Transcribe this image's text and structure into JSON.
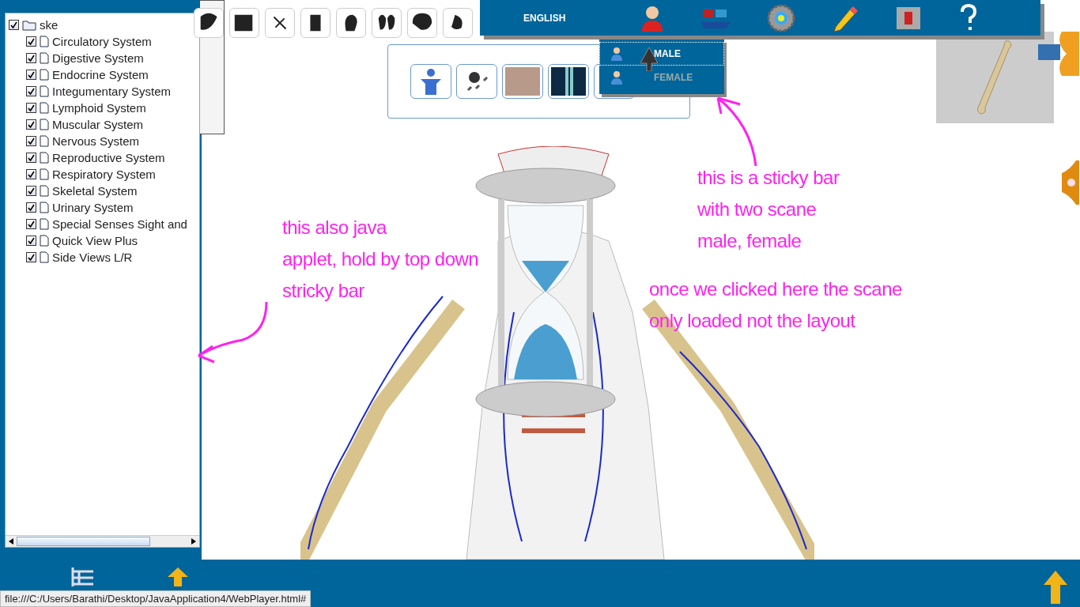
{
  "tree": {
    "root": {
      "label": "ske",
      "checked": true
    },
    "items": [
      {
        "label": "Circulatory System",
        "checked": true
      },
      {
        "label": "Digestive System",
        "checked": true
      },
      {
        "label": "Endocrine System",
        "checked": true
      },
      {
        "label": "Integumentary System",
        "checked": true
      },
      {
        "label": "Lymphoid System",
        "checked": true
      },
      {
        "label": "Muscular System",
        "checked": true
      },
      {
        "label": "Nervous System",
        "checked": true
      },
      {
        "label": "Reproductive System",
        "checked": true
      },
      {
        "label": "Respiratory System",
        "checked": true
      },
      {
        "label": "Skeletal System",
        "checked": true
      },
      {
        "label": "Urinary System",
        "checked": true
      },
      {
        "label": "Special Senses Sight and",
        "checked": true
      },
      {
        "label": "Quick View Plus",
        "checked": true
      },
      {
        "label": "Side Views L/R",
        "checked": true
      }
    ]
  },
  "top_toolbar": {
    "language": "ENGLISH"
  },
  "gender_menu": {
    "items": [
      {
        "label": "MALE",
        "selected": true
      },
      {
        "label": "FEMALE",
        "selected": false
      }
    ]
  },
  "annotations": [
    {
      "lines": [
        "this also java",
        "applet, hold by top down",
        "stricky bar"
      ]
    },
    {
      "lines": [
        "this is a sticky bar",
        "with two scane",
        "male, female"
      ]
    },
    {
      "lines": [
        "once we clicked here the scane",
        "only loaded not the layout"
      ]
    }
  ],
  "status_bar": {
    "url": "file:///C:/Users/Barathi/Desktop/JavaApplication4/WebPlayer.html#"
  }
}
